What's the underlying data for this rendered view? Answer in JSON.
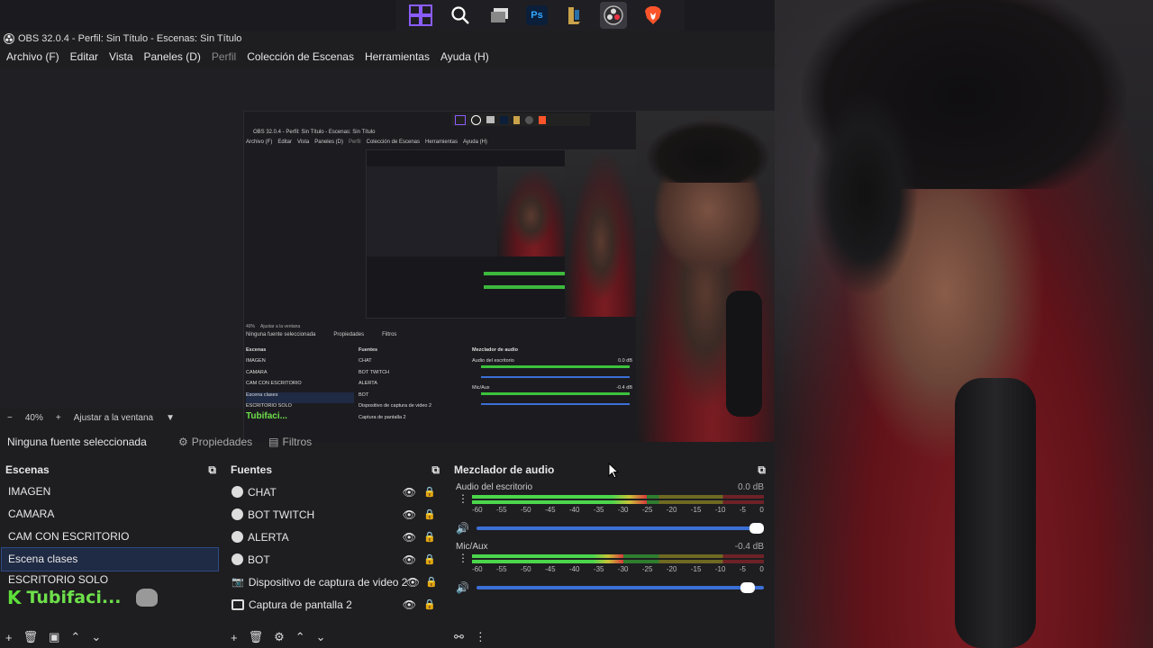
{
  "taskbar": {
    "icons": [
      "windows-start-icon",
      "search-icon",
      "taskview-icon",
      "photoshop-icon",
      "league-icon",
      "obs-icon",
      "brave-icon"
    ],
    "ps_label": "Ps"
  },
  "window": {
    "title": "OBS 32.0.4 - Perfil: Sin Título - Escenas: Sin Título"
  },
  "menu": [
    "Archivo (F)",
    "Editar",
    "Vista",
    "Paneles (D)",
    "Perfil",
    "Colección de Escenas",
    "Herramientas",
    "Ayuda (H)"
  ],
  "zoom": {
    "minus": "−",
    "value": "40%",
    "plus": "+",
    "fit_label": "Ajustar a la ventana"
  },
  "source_bar": {
    "no_source": "Ninguna fuente seleccionada",
    "properties": "Propiedades",
    "filters": "Filtros"
  },
  "scenes": {
    "title": "Escenas",
    "items": [
      "IMAGEN",
      "CAMARA",
      "CAM CON ESCRITORIO",
      "Escena clases",
      "ESCRITORIO SOLO"
    ],
    "selected_index": 3,
    "logo_text": "Tubifaci..."
  },
  "sources": {
    "title": "Fuentes",
    "items": [
      "CHAT",
      "BOT TWITCH",
      "ALERTA",
      "BOT",
      "Dispositivo de captura de video 2",
      "Captura de pantalla 2"
    ]
  },
  "mixer": {
    "title": "Mezclador de audio",
    "channels": [
      {
        "name": "Audio del escritorio",
        "db": "0.0 dB",
        "level": 0.6,
        "volume": 1.0
      },
      {
        "name": "Mic/Aux",
        "db": "-0.4 dB",
        "level": 0.52,
        "volume": 0.97
      }
    ],
    "ticks": [
      "-60",
      "-55",
      "-50",
      "-45",
      "-40",
      "-35",
      "-30",
      "-25",
      "-20",
      "-15",
      "-10",
      "-5",
      "0"
    ]
  },
  "nested": {
    "title": "OBS 32.0.4 - Perfil: Sin Título - Escenas: Sin Título",
    "menu": [
      "Archivo (F)",
      "Editar",
      "Vista",
      "Paneles (D)",
      "Perfil",
      "Colección de Escenas",
      "Herramientas",
      "Ayuda (H)"
    ],
    "no_source": "Ninguna fuente seleccionada",
    "properties": "Propiedades",
    "filters": "Filtros",
    "zoom_value": "40%",
    "zoom_fit": "Ajustar a la ventana",
    "scenes_title": "Escenas",
    "sources_title": "Fuentes",
    "mixer_title": "Mezclador de audio",
    "scenes": [
      "IMAGEN",
      "CAMARA",
      "CAM CON ESCRITORIO",
      "Escena clases",
      "ESCRITORIO SOLO"
    ],
    "sources": [
      "CHAT",
      "BOT TWITCH",
      "ALERTA",
      "BOT",
      "Dispositivo de captura de video 2",
      "Captura de pantalla 2"
    ],
    "mixer_ch1": "Audio del escritorio",
    "mixer_ch1_db": "0.0 dB",
    "mixer_ch2": "Mic/Aux",
    "mixer_ch2_db": "-0.4 dB",
    "logo_text": "Tubifaci..."
  }
}
